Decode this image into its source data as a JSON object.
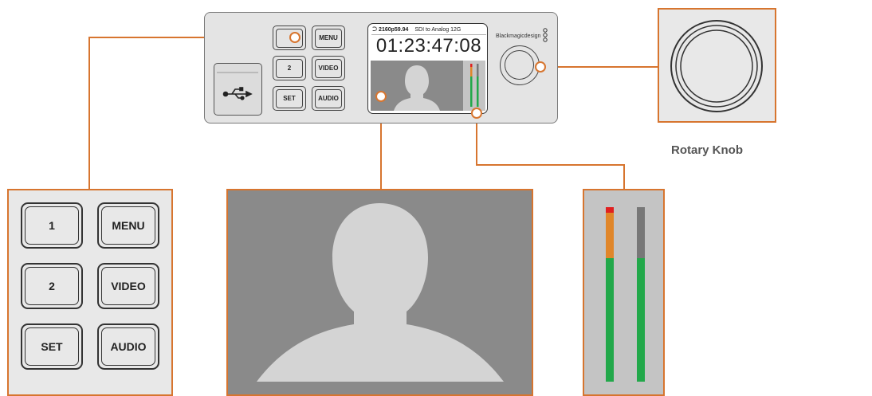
{
  "device": {
    "buttons": [
      {
        "id": "btn-1",
        "label": ""
      },
      {
        "id": "btn-menu",
        "label": "MENU"
      },
      {
        "id": "btn-2",
        "label": "2"
      },
      {
        "id": "btn-video",
        "label": "VIDEO"
      },
      {
        "id": "btn-set",
        "label": "SET"
      },
      {
        "id": "btn-audio",
        "label": "AUDIO"
      }
    ],
    "screen": {
      "format": "2160p59.94",
      "mode": "SDI to Analog 12G",
      "timecode": "01:23:47:08"
    },
    "brand": "Blackmagicdesign"
  },
  "callouts": {
    "buttons": [
      {
        "label": "1"
      },
      {
        "label": "MENU"
      },
      {
        "label": "2"
      },
      {
        "label": "VIDEO"
      },
      {
        "label": "SET"
      },
      {
        "label": "AUDIO"
      }
    ],
    "knob_caption": "Rotary Knob"
  },
  "colors": {
    "accent": "#d7752f",
    "meter_green": "#22a84a",
    "meter_amber": "#e0862a",
    "meter_red": "#e02020"
  },
  "icons": [
    "usb-icon",
    "rotary-knob-icon",
    "person-silhouette-icon"
  ]
}
